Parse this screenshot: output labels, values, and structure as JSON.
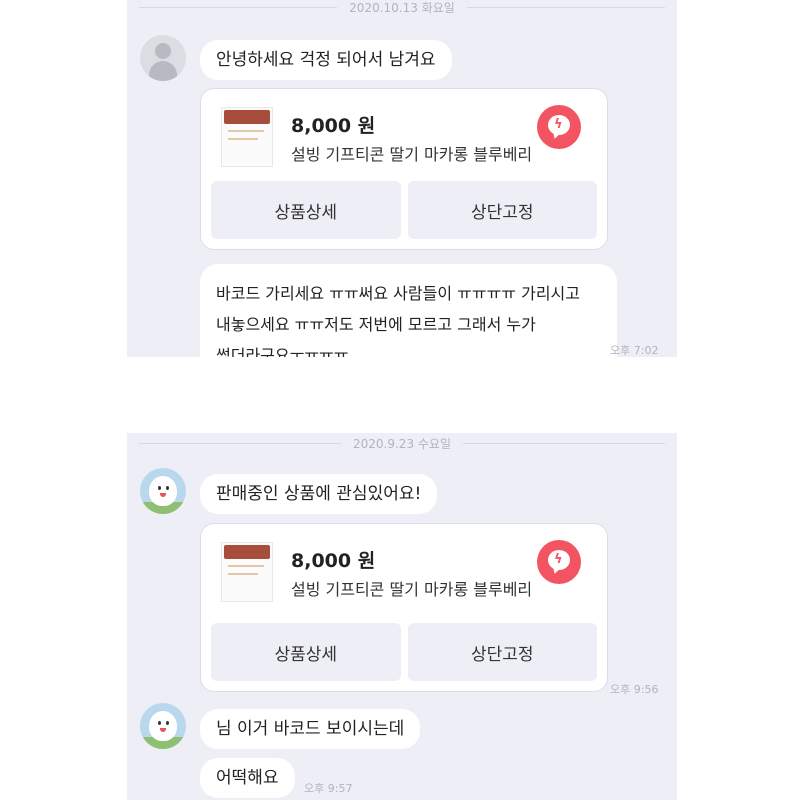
{
  "panel1": {
    "date": "2020.10.13 화요일",
    "message1": "안녕하세요 걱정 되어서 남겨요",
    "card": {
      "price": "8,000 원",
      "product_name": "설빙 기프티콘 딸기 마카롱 블루베리",
      "detail_button": "상품상세",
      "pin_button": "상단고정"
    },
    "message2_lines": [
      "바코드 가리세요 ㅠㅠ써요 사람들이 ㅠㅠㅠㅠ 가리시고",
      "내놓으세요 ㅠㅠ저도 저번에 모르고 그래서 누가",
      "썼더라구요ㅜㅠㅠㅠ"
    ],
    "time": "오후 7:02"
  },
  "panel2": {
    "date": "2020.9.23 수요일",
    "message1": "판매중인 상품에 관심있어요!",
    "card": {
      "price": "8,000 원",
      "product_name": "설빙 기프티콘 딸기 마카롱 블루베리",
      "detail_button": "상품상세",
      "pin_button": "상단고정"
    },
    "card_time": "오후 9:56",
    "message2": "님 이거 바코드 보이시는데",
    "message3": "어떡해요",
    "time": "오후 9:57"
  },
  "icons": {
    "default_avatar": "person-silhouette-icon",
    "character_avatar": "white-character-avatar",
    "talk_icon": "chat-lightning-icon"
  },
  "colors": {
    "chat_bg": "#eeeef6",
    "accent_red": "#f25461"
  }
}
